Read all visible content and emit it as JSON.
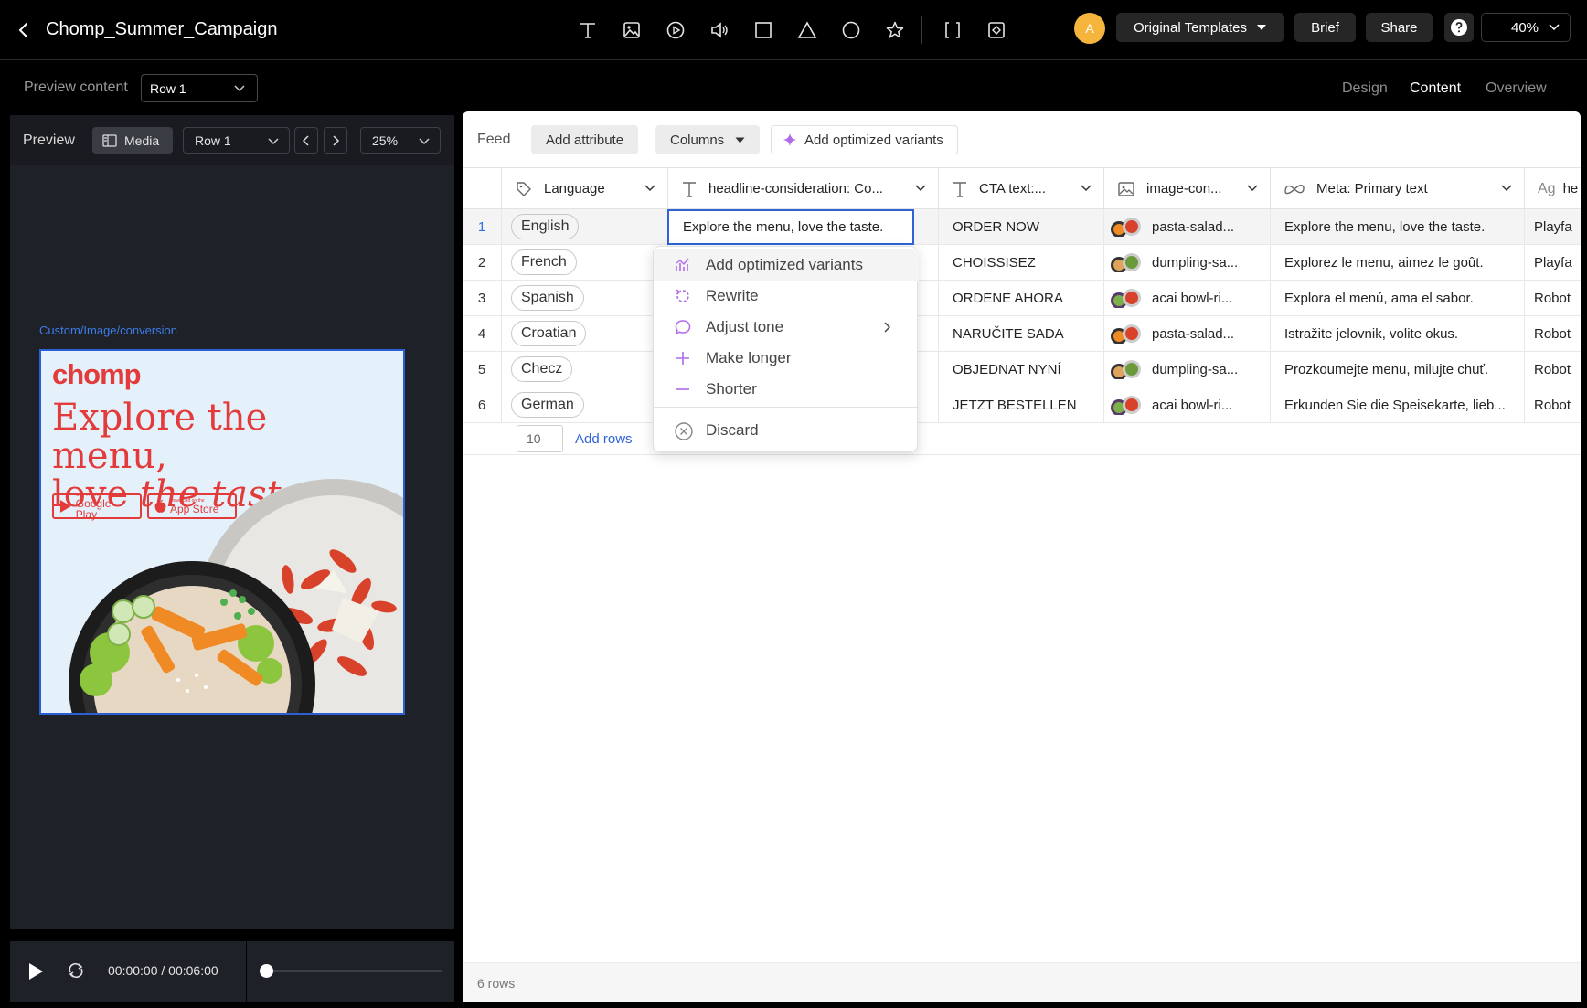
{
  "app": {
    "title": "Chomp_Summer_Campaign",
    "avatar_initial": "A",
    "template_menu_label": "Original Templates",
    "brief_label": "Brief",
    "share_label": "Share",
    "zoom": "40%",
    "toolbar_icons": [
      "text-tool-icon",
      "image-tool-icon",
      "video-tool-icon",
      "audio-tool-icon",
      "rectangle-tool-icon",
      "triangle-tool-icon",
      "circle-tool-icon",
      "star-tool-icon",
      "bracket-tool-icon",
      "component-tool-icon"
    ]
  },
  "subbar": {
    "preview_content_label": "Preview content",
    "row_select": "Row 1",
    "tabs": [
      {
        "label": "Design",
        "active": false
      },
      {
        "label": "Content",
        "active": true
      },
      {
        "label": "Overview",
        "active": false
      }
    ]
  },
  "preview": {
    "label": "Preview",
    "media_label": "Media",
    "row_select": "Row 1",
    "zoom": "25%",
    "canvas_label": "Custom/Image/conversion",
    "ad": {
      "logo": "chomp",
      "headline_line1": "Explore the menu,",
      "headline_line2_a": "love ",
      "headline_line2_b": "the taste.",
      "google_small": "GET IT ON",
      "google_big": "Google Play",
      "apple_small": "Download on the",
      "apple_big": "App Store"
    },
    "time": "00:00:00 / 00:06:00",
    "progress": 0
  },
  "feed": {
    "label": "Feed",
    "add_attribute": "Add attribute",
    "columns": "Columns",
    "add_optimized": "Add optimized variants",
    "headers": {
      "language": "Language",
      "headline": "headline-consideration: Co...",
      "cta": "CTA text:...",
      "image": "image-con...",
      "meta": "Meta: Primary text",
      "extra": "he"
    },
    "rows": [
      {
        "num": "1",
        "language": "English",
        "headline": "Explore the menu, love the taste.",
        "cta": "ORDER NOW",
        "image": "pasta-salad...",
        "meta": "Explore the menu, love the taste.",
        "extra": "Playfa"
      },
      {
        "num": "2",
        "language": "French",
        "headline": "",
        "cta": "CHOISSISEZ",
        "image": "dumpling-sa...",
        "meta": "Explorez le menu, aimez le goût.",
        "extra": "Playfa"
      },
      {
        "num": "3",
        "language": "Spanish",
        "headline": "",
        "cta": "ORDENE AHORA",
        "image": "acai bowl-ri...",
        "meta": "Explora el menú, ama el sabor.",
        "extra": "Robot"
      },
      {
        "num": "4",
        "language": "Croatian",
        "headline": "",
        "cta": "NARUČITE SADA",
        "image": "pasta-salad...",
        "meta": "Istražite jelovnik, volite okus.",
        "extra": "Robot"
      },
      {
        "num": "5",
        "language": "Checz",
        "headline": "",
        "cta": "OBJEDNAT NYNÍ",
        "image": "dumpling-sa...",
        "meta": "Prozkoumejte menu, milujte chuť.",
        "extra": "Robot"
      },
      {
        "num": "6",
        "language": "German",
        "headline": "",
        "cta": "JETZT BESTELLEN",
        "image": "acai bowl-ri...",
        "meta": "Erkunden Sie die Speisekarte, lieb...",
        "extra": "Robot"
      }
    ],
    "add_rows_count": "10",
    "add_rows_label": "Add rows",
    "row_count": "6 rows",
    "context_menu": [
      {
        "label": "Add optimized variants",
        "icon": "chart-sparkle-icon"
      },
      {
        "label": "Rewrite",
        "icon": "rewrite-icon"
      },
      {
        "label": "Adjust tone",
        "icon": "speech-bubble-icon"
      },
      {
        "label": "Make longer",
        "icon": "plus-icon"
      },
      {
        "label": "Shorter",
        "icon": "minus-icon"
      },
      {
        "label": "Discard",
        "icon": "discard-icon"
      }
    ]
  },
  "colors": {
    "brand_red": "#e33a3a",
    "accent_blue": "#2f63d7",
    "ai_purple": "#b16be8",
    "avatar_yellow": "#f5b53d"
  }
}
